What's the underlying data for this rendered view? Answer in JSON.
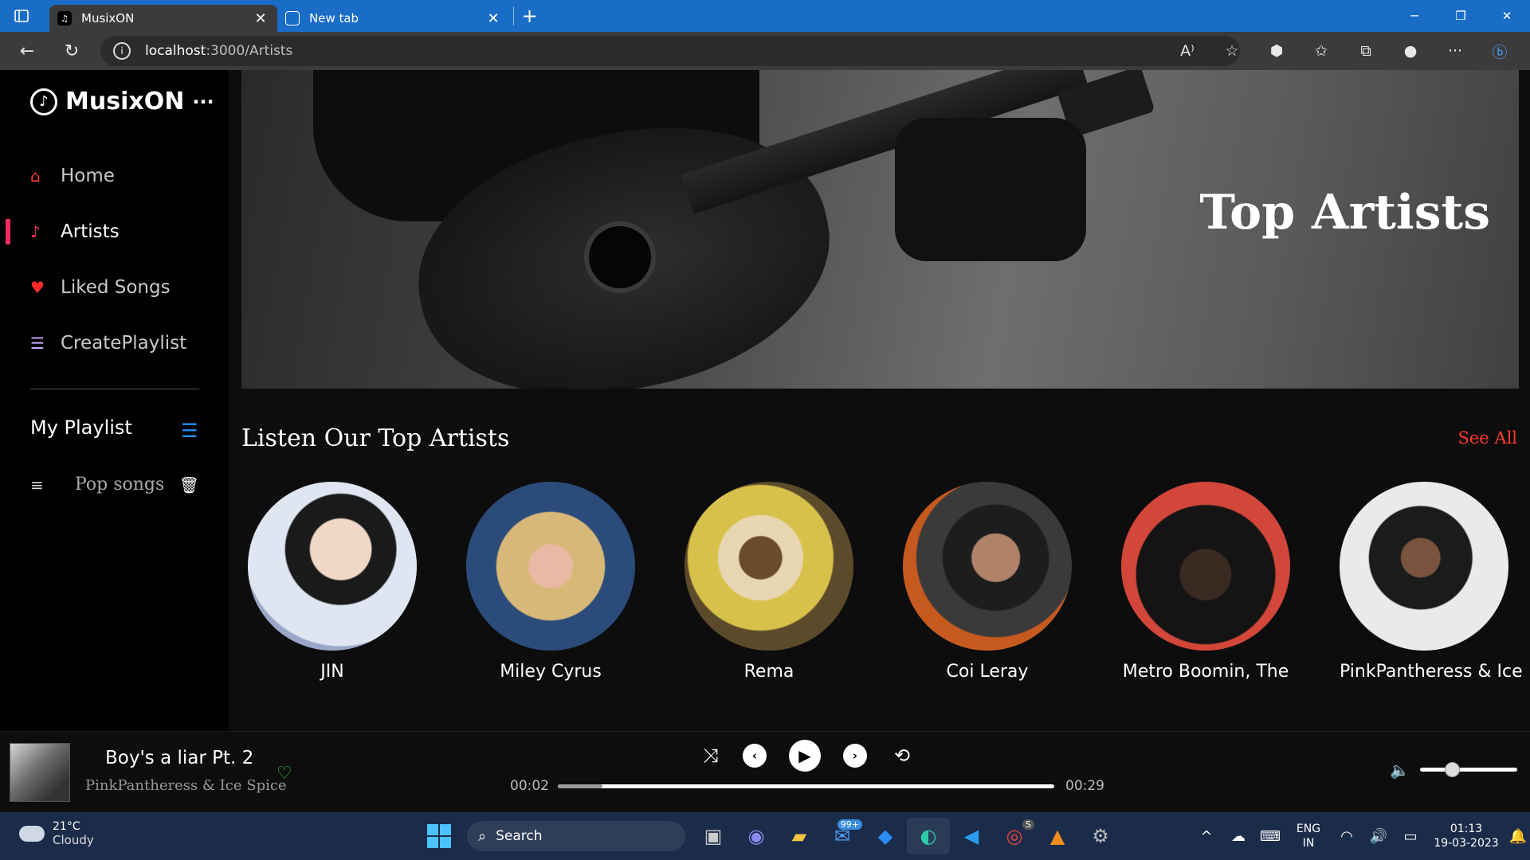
{
  "browser": {
    "tabs": [
      {
        "title": "MusixON",
        "active": true
      },
      {
        "title": "New tab",
        "active": false
      }
    ],
    "url_host": "localhost",
    "url_path": ":3000/Artists"
  },
  "sidebar": {
    "brand": "MusixON",
    "items": [
      {
        "label": "Home",
        "icon": "home-icon"
      },
      {
        "label": "Artists",
        "icon": "music-note-icon"
      },
      {
        "label": "Liked Songs",
        "icon": "heart-icon"
      },
      {
        "label": "CreatePlaylist",
        "icon": "playlist-add-icon"
      }
    ],
    "active_item": "Artists",
    "my_playlist": "My Playlist",
    "playlists": [
      {
        "name": "Pop songs"
      }
    ]
  },
  "hero": {
    "title": "Top Artists"
  },
  "section": {
    "title": "Listen Our Top Artists",
    "see_all": "See All"
  },
  "artists": [
    {
      "name": "JIN"
    },
    {
      "name": "Miley Cyrus"
    },
    {
      "name": "Rema"
    },
    {
      "name": "Coi Leray"
    },
    {
      "name": "Metro Boomin, The"
    },
    {
      "name": "PinkPantheress & Ice"
    }
  ],
  "player": {
    "song": "Boy's a liar Pt. 2",
    "artist": "PinkPantheress & Ice Spice",
    "current_time": "00:02",
    "duration": "00:29",
    "progress": 0.09,
    "volume": 0.33
  },
  "taskbar": {
    "temp": "21°C",
    "weather": "Cloudy",
    "search": "Search",
    "mail_badge": "99+",
    "chrome_badge": "S",
    "lang1": "ENG",
    "lang2": "IN",
    "time": "01:13",
    "date": "19-03-2023"
  },
  "colors": {
    "accent": "#ff2b5e",
    "see_all": "#ff3a2e",
    "liked": "#26c33c",
    "playlist_icon": "#1e90ff",
    "taskbar": "#1b2c4a",
    "titlebar": "#1a6dc7"
  }
}
